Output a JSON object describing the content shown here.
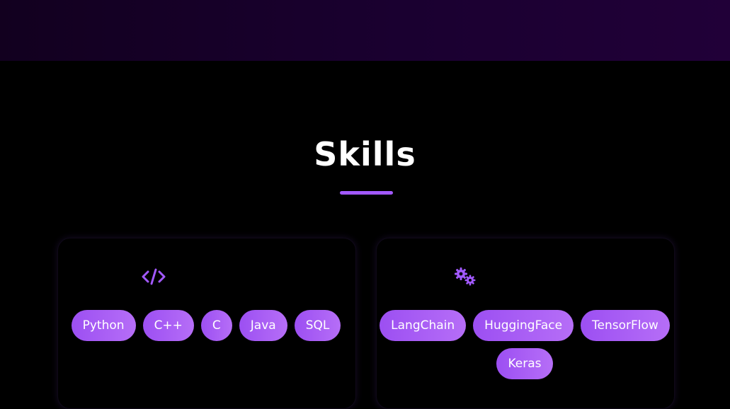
{
  "section": {
    "title": "Skills"
  },
  "cards": [
    {
      "icon": "code-icon",
      "skills": [
        "Python",
        "C++",
        "C",
        "Java",
        "SQL"
      ]
    },
    {
      "icon": "gears-icon",
      "skills": [
        "LangChain",
        "HuggingFace",
        "TensorFlow",
        "Keras"
      ]
    }
  ],
  "colors": {
    "accent": "#a259ff",
    "chip_gradient_start": "#9c4ff2",
    "chip_gradient_end": "#b66ef7",
    "background": "#000000",
    "header_band": "#1a0030"
  }
}
